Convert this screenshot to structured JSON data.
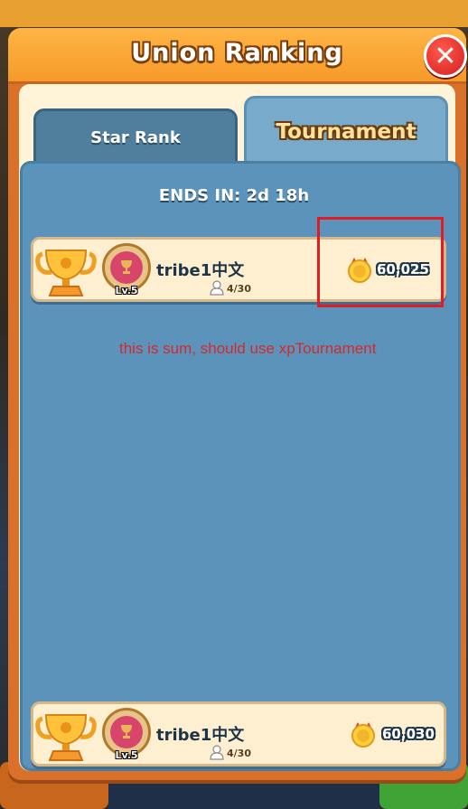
{
  "header": {
    "title": "Union Ranking"
  },
  "tabs": [
    {
      "label": "Star Rank",
      "active": false
    },
    {
      "label": "Tournament",
      "active": true
    }
  ],
  "countdown": "ENDS IN: 2d 18h",
  "rows": [
    {
      "name": "tribe1中文",
      "level": "Lv.5",
      "members": "4/30",
      "score": "60,025"
    },
    {
      "name": "tribe1中文",
      "level": "Lv.5",
      "members": "4/30",
      "score": "60,030"
    }
  ],
  "annotation": {
    "text": "this is sum, should use xpTournament",
    "color": "#e01c24"
  },
  "colors": {
    "header": "#f59a2a",
    "panel": "#5c93bb",
    "row": "#fdefd0",
    "close": "#d51e22"
  }
}
